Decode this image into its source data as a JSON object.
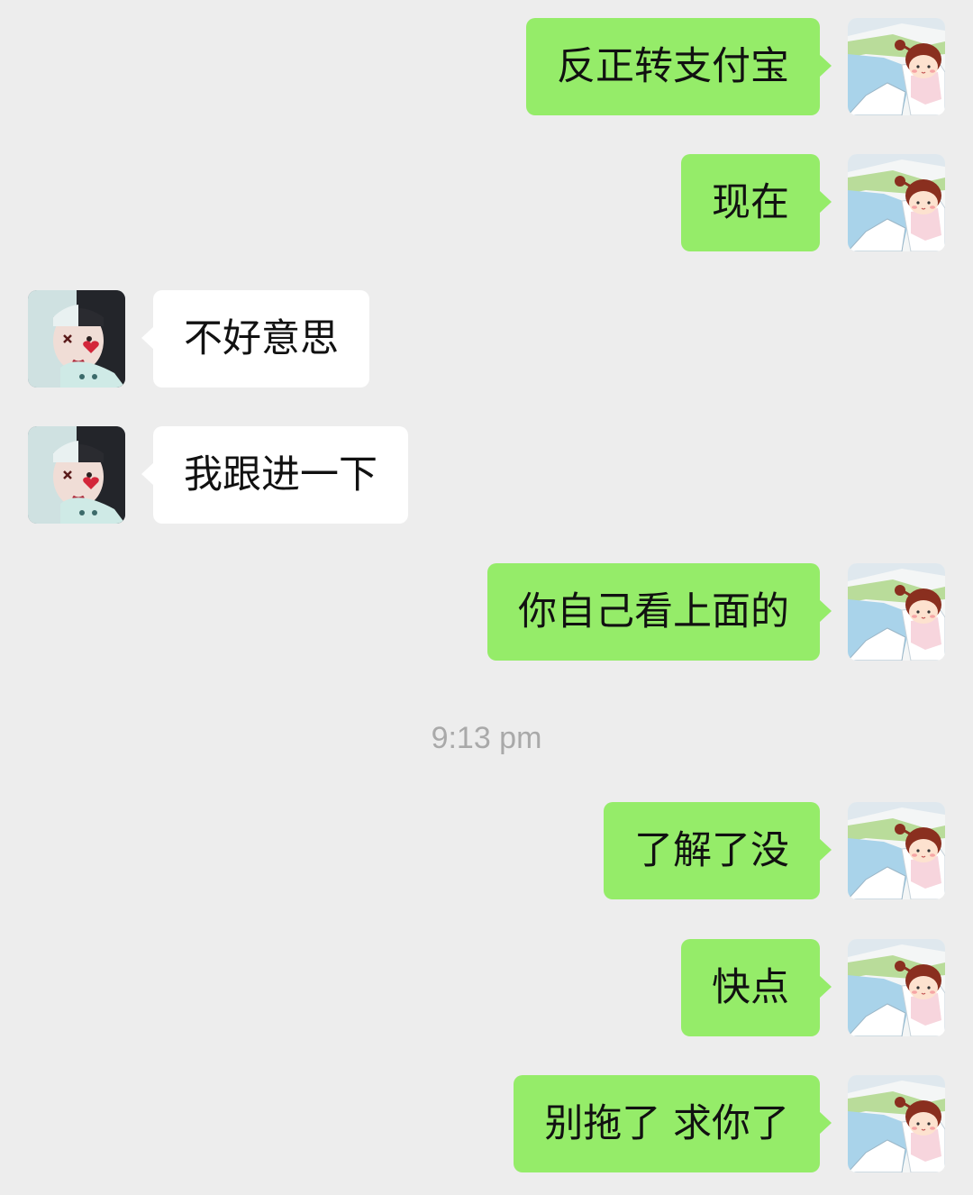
{
  "chat": {
    "colors": {
      "background": "#ededed",
      "outgoing_bubble": "#95ec69",
      "incoming_bubble": "#ffffff",
      "timestamp_text": "#a9a9a9"
    },
    "avatars": {
      "me": "cartoon-girl-avatar",
      "contact": "girl-photo-avatar"
    },
    "messages": [
      {
        "sender": "me",
        "text": "反正转支付宝"
      },
      {
        "sender": "me",
        "text": "现在"
      },
      {
        "sender": "contact",
        "text": "不好意思"
      },
      {
        "sender": "contact",
        "text": "我跟进一下"
      },
      {
        "sender": "me",
        "text": "你自己看上面的"
      },
      {
        "sender": "me",
        "text": "了解了没"
      },
      {
        "sender": "me",
        "text": "快点"
      },
      {
        "sender": "me",
        "text": "别拖了 求你了"
      }
    ],
    "timestamp": "9:13 pm"
  }
}
